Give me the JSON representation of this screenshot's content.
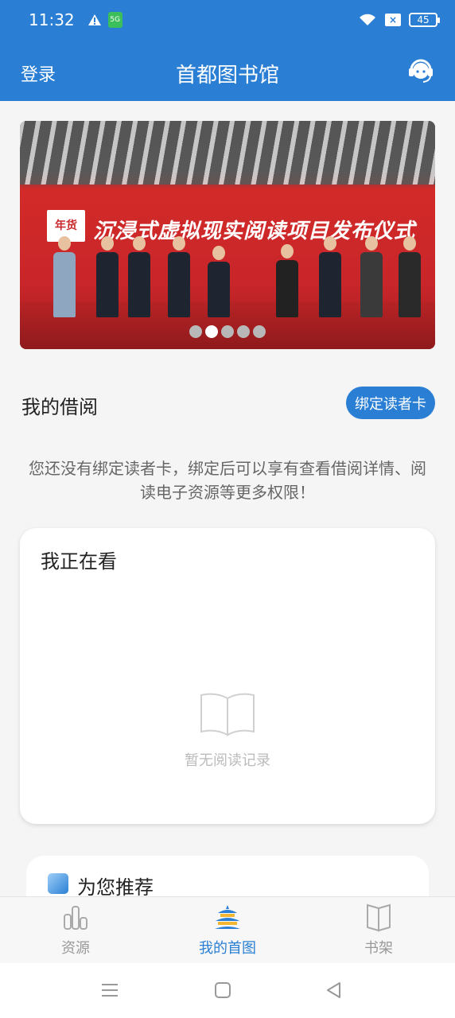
{
  "status_bar": {
    "time": "11:32",
    "sim_label": "5G",
    "x_box": "×",
    "battery": "45"
  },
  "header": {
    "login_label": "登录",
    "title": "首都图书馆",
    "service_icon": "headset-icon"
  },
  "banner": {
    "backdrop_text": "沉浸式虚拟现实阅读项目发布仪式",
    "logo_text": "年货",
    "slides": 5,
    "active_slide": 2
  },
  "borrow": {
    "title": "我的借阅",
    "bind_button": "绑定读者卡",
    "notice": "您还没有绑定读者卡，绑定后可以享有查看借阅详情、阅读电子资源等更多权限！"
  },
  "reading": {
    "title": "我正在看",
    "empty_text": "暂无阅读记录"
  },
  "recommend": {
    "title": "为您推荐"
  },
  "tabs": [
    {
      "label": "资源",
      "icon": "bar-chart-icon",
      "active": false
    },
    {
      "label": "我的首图",
      "icon": "temple-icon",
      "active": true
    },
    {
      "label": "书架",
      "icon": "book-icon",
      "active": false
    }
  ],
  "colors": {
    "primary": "#2a7fd4",
    "inactive": "#999999"
  }
}
